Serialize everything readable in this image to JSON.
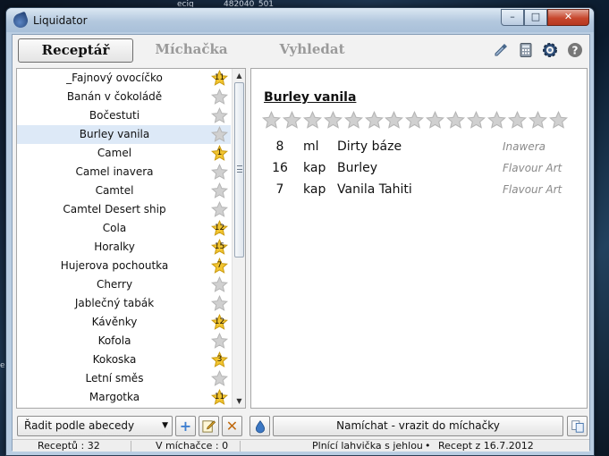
{
  "desktop": {
    "top_left": "ecig",
    "top_right": "482040_501",
    "left_edge": "e"
  },
  "window": {
    "title": "Liquidator",
    "minimize": "–",
    "maximize": "□",
    "close": "✕"
  },
  "tabs": [
    {
      "label": "Receptář",
      "active": true
    },
    {
      "label": "Míchačka",
      "active": false
    },
    {
      "label": "Vyhledat",
      "active": false
    }
  ],
  "toolbar_icons": [
    "dropper-icon",
    "calculator-icon",
    "settings-icon",
    "help-icon"
  ],
  "help_label": "?",
  "recipes": [
    {
      "name": "_Fajnový ovocíčko",
      "count": "11",
      "filled": true
    },
    {
      "name": "Banán v čokoládě",
      "count": "",
      "filled": false
    },
    {
      "name": "Bočestuti",
      "count": "",
      "filled": false
    },
    {
      "name": "Burley vanila",
      "count": "",
      "filled": false,
      "selected": true
    },
    {
      "name": "Camel",
      "count": "1",
      "filled": true
    },
    {
      "name": "Camel inavera",
      "count": "",
      "filled": false
    },
    {
      "name": "Camtel",
      "count": "",
      "filled": false
    },
    {
      "name": "Camtel Desert ship",
      "count": "",
      "filled": false
    },
    {
      "name": "Cola",
      "count": "12",
      "filled": true
    },
    {
      "name": "Horalky",
      "count": "15",
      "filled": true
    },
    {
      "name": "Hujerova pochoutka",
      "count": "7",
      "filled": true
    },
    {
      "name": "Cherry",
      "count": "",
      "filled": false
    },
    {
      "name": "Jablečný tabák",
      "count": "",
      "filled": false
    },
    {
      "name": "Kávěnky",
      "count": "12",
      "filled": true
    },
    {
      "name": "Kofola",
      "count": "",
      "filled": false
    },
    {
      "name": "Kokoska",
      "count": "3",
      "filled": true
    },
    {
      "name": "Letní směs",
      "count": "",
      "filled": false
    },
    {
      "name": "Margotka",
      "count": "11",
      "filled": true
    }
  ],
  "scroll": {
    "up": "▲",
    "down": "▼"
  },
  "detail": {
    "title": "Burley vanila",
    "rating": 0,
    "rating_max": 15,
    "ingredients": [
      {
        "amount": "8",
        "unit": "ml",
        "name": "Dirty báze",
        "brand": "Inawera"
      },
      {
        "amount": "16",
        "unit": "kap",
        "name": "Burley",
        "brand": "Flavour Art"
      },
      {
        "amount": "7",
        "unit": "kap",
        "name": "Vanila Tahiti",
        "brand": "Flavour Art"
      }
    ]
  },
  "bottom": {
    "sort_label": "Řadit podle abecedy",
    "sort_arrow": "▼",
    "add": "+",
    "delete": "✕",
    "mix_label": "Namíchat - vrazit do míchačky"
  },
  "status": {
    "recipes": "Receptů : 32",
    "in_mixer": "V míchačce : 0",
    "bottle": "Plnící lahvička s jehlou",
    "bullet": "•",
    "recipe_date": "Recept z 16.7.2012"
  },
  "colors": {
    "star_filled": "#f2c530",
    "star_empty": "#d0d0d0",
    "selection": "#dde9f7"
  }
}
